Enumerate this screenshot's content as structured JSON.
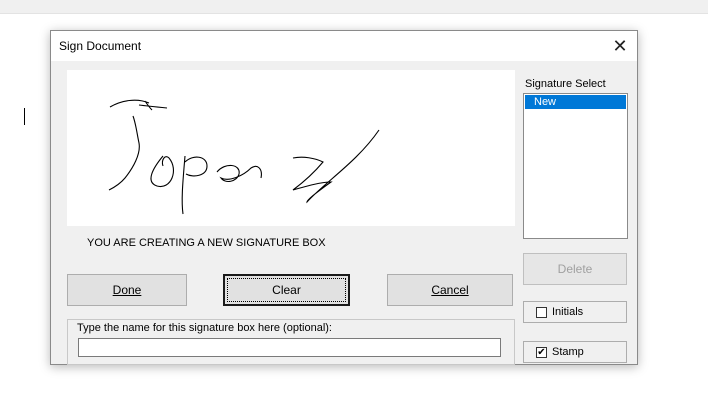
{
  "dialog": {
    "title": "Sign Document",
    "close_glyph": "✕",
    "status_text": "YOU ARE CREATING A NEW SIGNATURE BOX"
  },
  "buttons": {
    "done": "Done",
    "clear": "Clear",
    "cancel": "Cancel",
    "delete": "Delete"
  },
  "name_field": {
    "label": "Type the name for this signature box here (optional):",
    "value": ""
  },
  "signature_select": {
    "label": "Signature Select",
    "items": [
      "New"
    ],
    "selected": "New"
  },
  "options": {
    "initials": {
      "label": "Initials",
      "checked": false
    },
    "stamp": {
      "label": "Stamp",
      "checked": true,
      "check_glyph": "✔"
    }
  },
  "colors": {
    "selection": "#0078d7",
    "dialog_bg": "#f0f0f0"
  }
}
